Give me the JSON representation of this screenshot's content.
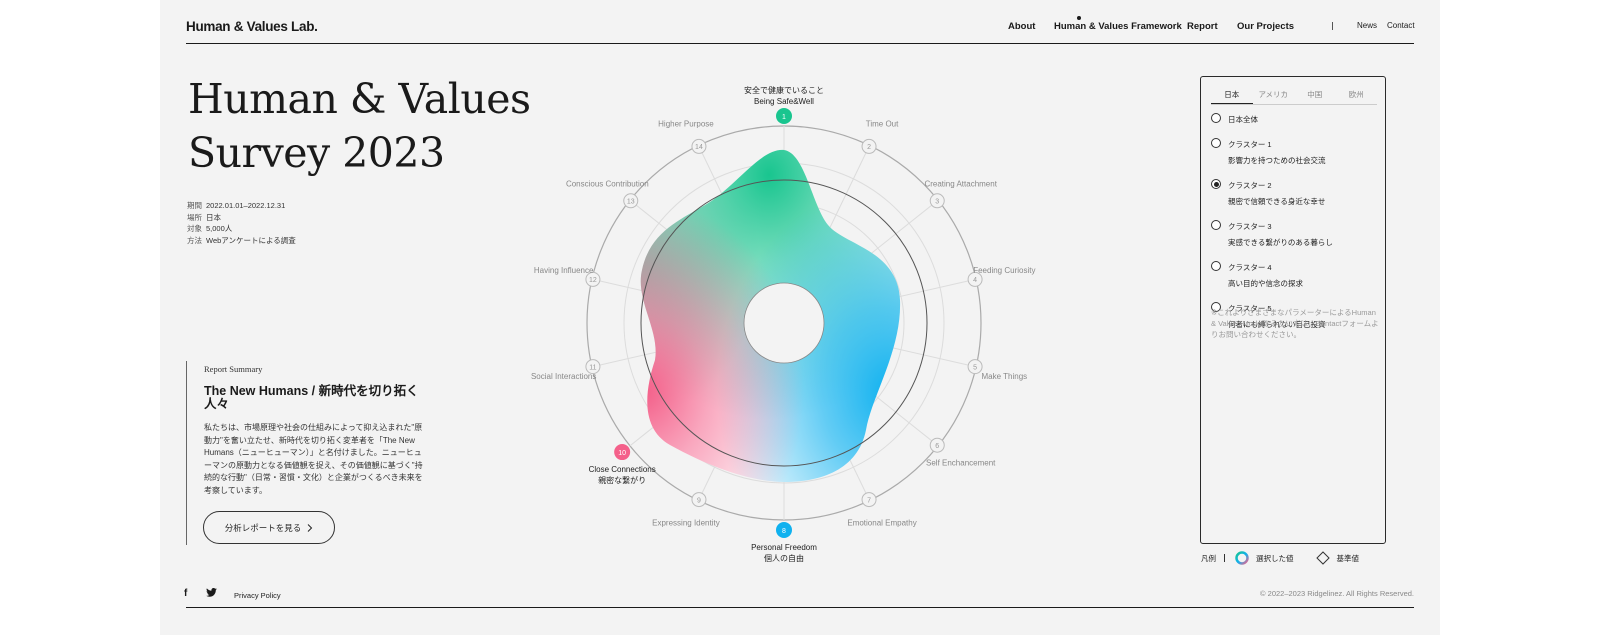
{
  "header": {
    "logo": "Human & Values Lab.",
    "nav": [
      "About",
      "Human & Values Framework",
      "Report",
      "Our Projects"
    ],
    "nav_secondary": [
      "News",
      "Contact"
    ]
  },
  "hero": {
    "title_line1": "Human & Values",
    "title_line2": "Survey 2023",
    "meta": [
      {
        "key": "期間",
        "value": "2022.01.01–2022.12.31"
      },
      {
        "key": "場所",
        "value": "日本"
      },
      {
        "key": "対象",
        "value": "5,000人"
      },
      {
        "key": "方法",
        "value": "Webアンケートによる調査"
      }
    ]
  },
  "summary": {
    "label": "Report Summary",
    "heading": "The New Humans / 新時代を切り拓く人々",
    "body": "私たちは、市場原理や社会の仕組みによって抑え込まれた\"原動力\"を奮い立たせ、新時代を切り拓く変革者を「The New Humans（ニューヒューマン）」と名付けました。ニューヒューマンの原動力となる価値観を捉え、その価値観に基づく\"持続的な行動\"（日常・習慣・文化）と企業がつくるべき未来を考察しています。",
    "button": "分析レポートを見る",
    "button_icon": "chevron-right-icon"
  },
  "radar": {
    "axes": [
      {
        "num": "1",
        "label": "Being Safe&Well",
        "jp": "安全で健康でいること",
        "highlight": true,
        "color": "#19c58f"
      },
      {
        "num": "2",
        "label": "Time Out"
      },
      {
        "num": "3",
        "label": "Creating Attachment"
      },
      {
        "num": "4",
        "label": "Feeding Curiosity"
      },
      {
        "num": "5",
        "label": "Make Things"
      },
      {
        "num": "6",
        "label": "Self Enchancement"
      },
      {
        "num": "7",
        "label": "Emotional Empathy"
      },
      {
        "num": "8",
        "label": "Personal Freedom",
        "jp": "個人の自由",
        "highlight": true,
        "color": "#0fb1ef"
      },
      {
        "num": "9",
        "label": "Expressing Identity"
      },
      {
        "num": "10",
        "label": "Close Connections",
        "jp": "親密な繋がり",
        "highlight": true,
        "color": "#f4608a"
      },
      {
        "num": "11",
        "label": "Social Interactions"
      },
      {
        "num": "12",
        "label": "Having Influence"
      },
      {
        "num": "13",
        "label": "Conscious Contribution"
      },
      {
        "num": "14",
        "label": "Higher Purpose"
      }
    ],
    "colors": {
      "green": "#19c58f",
      "blue": "#0fb1ef",
      "pink": "#f4608a"
    }
  },
  "panel": {
    "tabs": [
      "日本",
      "アメリカ",
      "中国",
      "欧州"
    ],
    "active_tab": "日本",
    "options": [
      {
        "title": "日本全体",
        "sub": "",
        "selected": false
      },
      {
        "title": "クラスター 1",
        "sub": "影響力を持つための社会交流",
        "selected": false
      },
      {
        "title": "クラスター 2",
        "sub": "親密で信頼できる身近な幸せ",
        "selected": true
      },
      {
        "title": "クラスター 3",
        "sub": "実感できる繋がりのある暮らし",
        "selected": false
      },
      {
        "title": "クラスター 4",
        "sub": "高い目的や信念の探求",
        "selected": false
      },
      {
        "title": "クラスター 5",
        "sub": "何者にも縛られない自己投資",
        "selected": false
      }
    ],
    "note": "※これよりさまざまなパラメーターによるHuman & Values Modelをみたい方は、Contactフォームよりお問い合わせください。"
  },
  "legend": {
    "label": "凡例",
    "selected": "選択した値",
    "baseline": "基準値"
  },
  "footer": {
    "icons": [
      "facebook-icon",
      "twitter-icon"
    ],
    "privacy": "Privacy Policy",
    "copyright": "© 2022–2023 Ridgelinez. All Rights Reserved."
  }
}
